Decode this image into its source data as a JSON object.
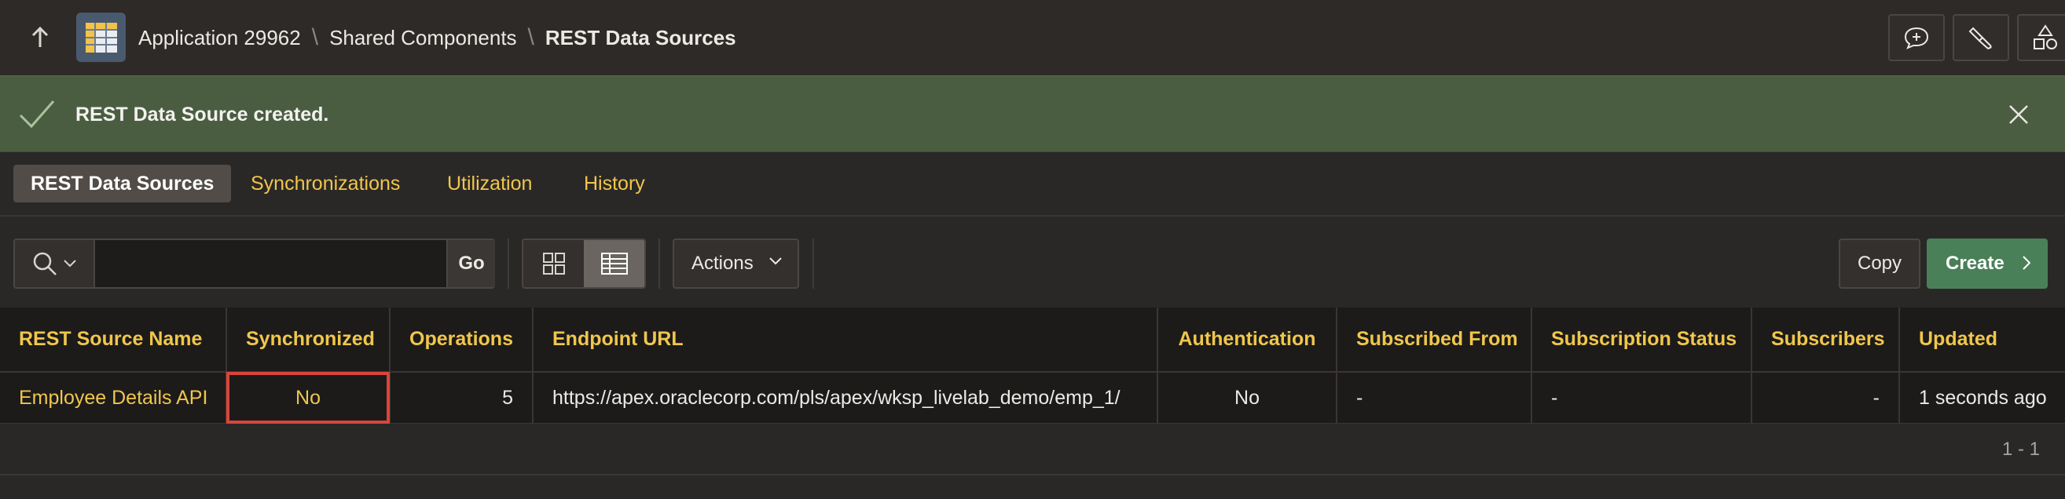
{
  "breadcrumb": {
    "items": [
      "Application 29962",
      "Shared Components",
      "REST Data Sources"
    ],
    "separator": "\\"
  },
  "header": {
    "up_icon": "arrow-up-icon",
    "app_icon": "grid-table-icon",
    "buttons": [
      "chat-plus-icon",
      "brush-icon",
      "shapes-icon"
    ]
  },
  "alert": {
    "message": "REST Data Source created.",
    "icon": "checkmark-icon",
    "close_icon": "close-icon",
    "color": "#4b5d41"
  },
  "tabs": [
    {
      "label": "REST Data Sources",
      "active": true
    },
    {
      "label": "Synchronizations",
      "active": false
    },
    {
      "label": "Utilization",
      "active": false
    },
    {
      "label": "History",
      "active": false
    }
  ],
  "toolbar": {
    "search_value": "",
    "go_label": "Go",
    "actions_label": "Actions",
    "copy_label": "Copy",
    "create_label": "Create"
  },
  "table": {
    "columns": [
      "REST Source Name",
      "Synchronized",
      "Operations",
      "Endpoint URL",
      "Authentication",
      "Subscribed From",
      "Subscription Status",
      "Subscribers",
      "Updated"
    ],
    "rows": [
      {
        "rest_source_name": "Employee Details API",
        "synchronized": "No",
        "operations": "5",
        "endpoint_url": "https://apex.oraclecorp.com/pls/apex/wksp_livelab_demo/emp_1/",
        "authentication": "No",
        "subscribed_from": "-",
        "subscription_status": "-",
        "subscribers": "-",
        "updated": "1 seconds ago"
      }
    ]
  },
  "pagination": {
    "text": "1 - 1"
  },
  "colors": {
    "accent": "#f0c64c",
    "create": "#4a8058",
    "highlight": "#d9453a"
  }
}
